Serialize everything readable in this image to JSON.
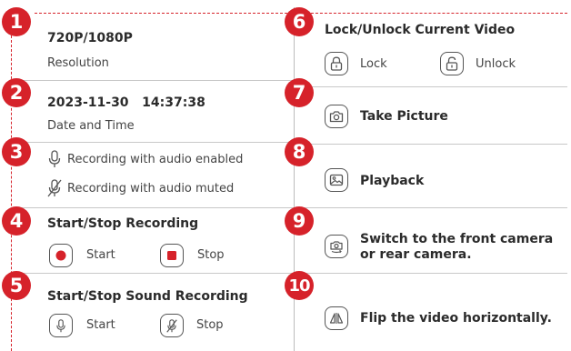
{
  "badges": [
    "1",
    "2",
    "3",
    "4",
    "5",
    "6",
    "7",
    "8",
    "9",
    "10"
  ],
  "colors": {
    "accent": "#d6222a",
    "text": "#333333",
    "divider": "#c8c8c8"
  },
  "left": {
    "resolution": {
      "title": "720P/1080P",
      "caption": "Resolution"
    },
    "datetime": {
      "title": "2023-11-30   14:37:38",
      "caption": "Date and Time"
    },
    "audio": {
      "enabled": "Recording with audio enabled",
      "muted": "Recording with audio muted",
      "enabled_icon": "microphone-icon",
      "muted_icon": "microphone-muted-icon"
    },
    "recording": {
      "title": "Start/Stop Recording",
      "start": "Start",
      "stop": "Stop",
      "start_icon": "record-dot-icon",
      "stop_icon": "stop-square-icon"
    },
    "sound": {
      "title": "Start/Stop Sound Recording",
      "start": "Start",
      "stop": "Stop",
      "start_icon": "microphone-icon",
      "stop_icon": "microphone-muted-icon"
    }
  },
  "right": {
    "lock": {
      "title": "Lock/Unlock Current Video",
      "lock": "Lock",
      "unlock": "Unlock",
      "lock_icon": "lock-icon",
      "unlock_icon": "unlock-icon"
    },
    "picture": {
      "label": "Take Picture",
      "icon": "camera-icon"
    },
    "playback": {
      "label": "Playback",
      "icon": "image-icon"
    },
    "switch": {
      "line1": "Switch to the front camera",
      "line2": "or rear camera.",
      "icon": "switch-camera-icon"
    },
    "flip": {
      "label": "Flip the video horizontally.",
      "icon": "flip-icon"
    }
  }
}
